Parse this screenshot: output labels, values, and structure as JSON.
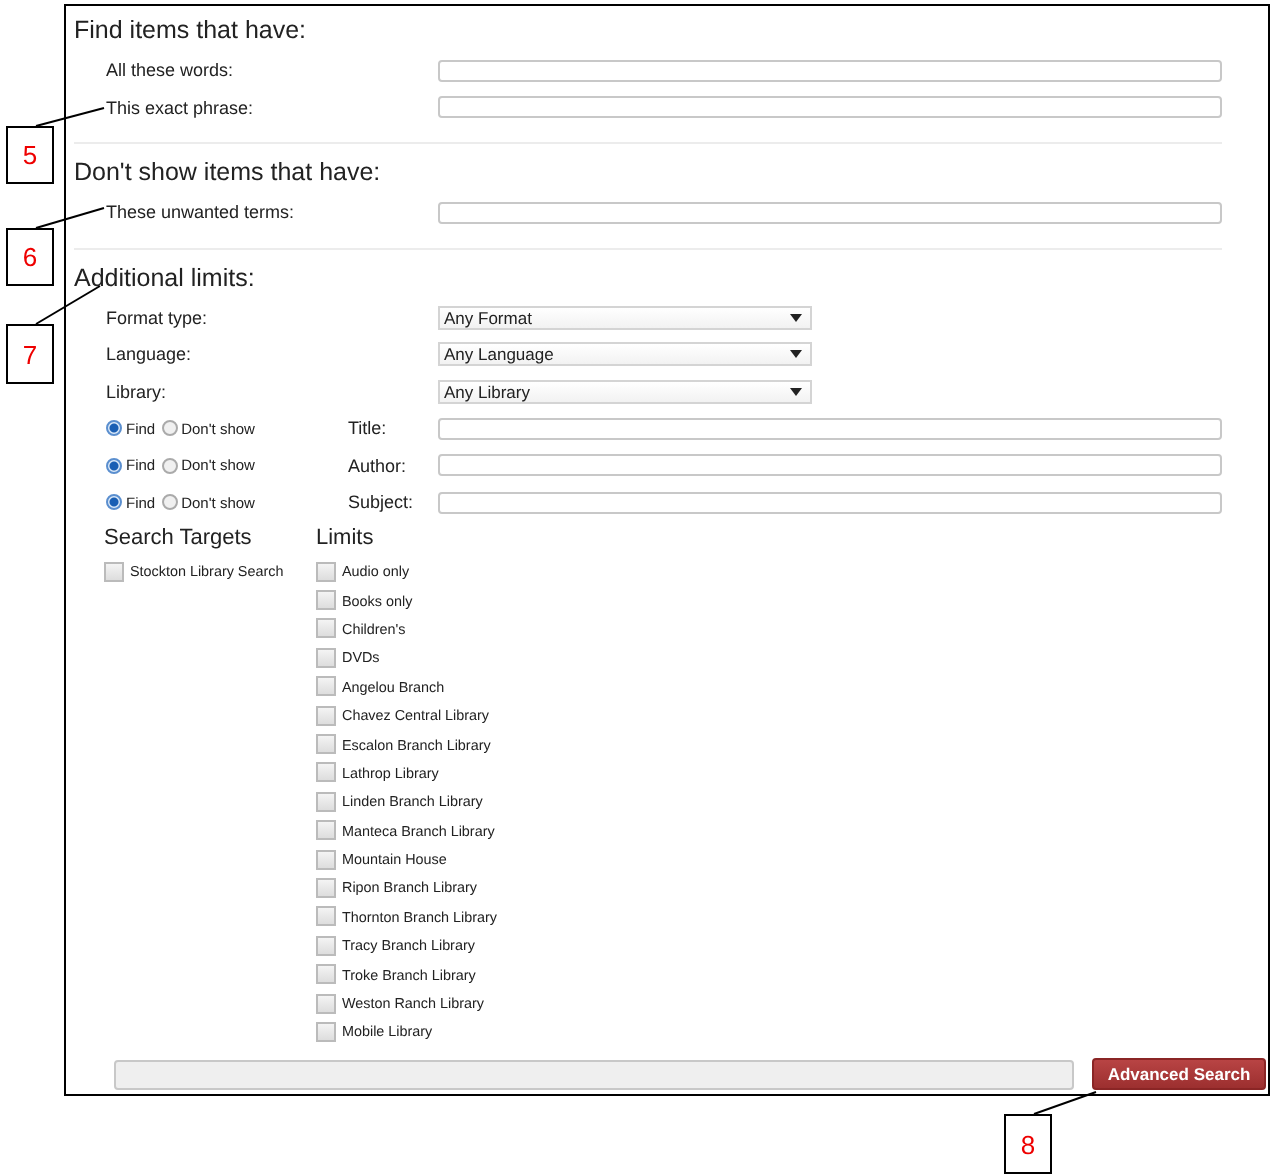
{
  "find": {
    "heading": "Find items that have:",
    "fields": [
      {
        "label": "All these words:"
      },
      {
        "label": "This exact phrase:"
      }
    ]
  },
  "exclude": {
    "heading": "Don't show items that have:",
    "fields": [
      {
        "label": "These unwanted terms:"
      }
    ]
  },
  "limits": {
    "heading": "Additional limits:",
    "dropdowns": [
      {
        "label": "Format type:",
        "value": "Any Format"
      },
      {
        "label": "Language:",
        "value": "Any Language"
      },
      {
        "label": "Library:",
        "value": "Any Library"
      }
    ],
    "field_limits": [
      {
        "label": "Title:",
        "options": [
          {
            "label": "Find",
            "selected": true
          },
          {
            "label": "Don't show",
            "selected": false
          }
        ]
      },
      {
        "label": "Author:",
        "options": [
          {
            "label": "Find",
            "selected": true
          },
          {
            "label": "Don't show",
            "selected": false
          }
        ]
      },
      {
        "label": "Subject:",
        "options": [
          {
            "label": "Find",
            "selected": true
          },
          {
            "label": "Don't show",
            "selected": false
          }
        ]
      }
    ]
  },
  "search_targets": {
    "heading": "Search Targets",
    "items": [
      {
        "label": "Stockton Library Search",
        "checked": false
      }
    ]
  },
  "limit_options": {
    "heading": "Limits",
    "items": [
      {
        "label": "Audio only",
        "checked": false
      },
      {
        "label": "Books only",
        "checked": false
      },
      {
        "label": "Children's",
        "checked": false
      },
      {
        "label": "DVDs",
        "checked": false
      },
      {
        "label": "Angelou Branch",
        "checked": false
      },
      {
        "label": "Chavez Central Library",
        "checked": false
      },
      {
        "label": "Escalon Branch Library",
        "checked": false
      },
      {
        "label": "Lathrop Library",
        "checked": false
      },
      {
        "label": "Linden Branch Library",
        "checked": false
      },
      {
        "label": "Manteca Branch Library",
        "checked": false
      },
      {
        "label": "Mountain House",
        "checked": false
      },
      {
        "label": "Ripon Branch Library",
        "checked": false
      },
      {
        "label": "Thornton Branch Library",
        "checked": false
      },
      {
        "label": "Tracy Branch Library",
        "checked": false
      },
      {
        "label": "Troke Branch Library",
        "checked": false
      },
      {
        "label": "Weston Ranch Library",
        "checked": false
      },
      {
        "label": "Mobile Library",
        "checked": false
      }
    ]
  },
  "submit_button": "Advanced Search",
  "callouts": [
    {
      "number": "5"
    },
    {
      "number": "6"
    },
    {
      "number": "7"
    },
    {
      "number": "8"
    }
  ]
}
